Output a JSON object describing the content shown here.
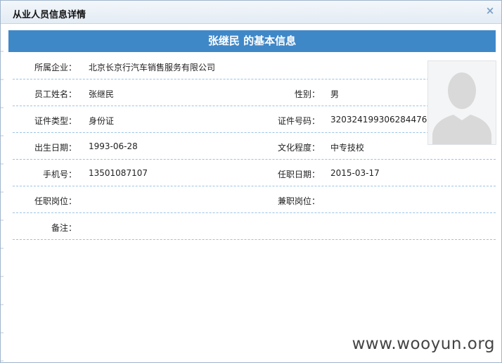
{
  "dialog": {
    "title": "从业人员信息详情",
    "close_icon": "×",
    "banner": "张继民 的基本信息"
  },
  "rows": [
    {
      "label": "所属企业：",
      "value": "北京长京行汽车销售服务有限公司"
    },
    {
      "label": "员工姓名：",
      "value": "张继民",
      "label2": "性别：",
      "value2": "男"
    },
    {
      "label": "证件类型：",
      "value": "身份证",
      "label2": "证件号码：",
      "value2": "320324199306284476"
    },
    {
      "label": "出生日期：",
      "value": "1993-06-28",
      "label2": "文化程度：",
      "value2": "中专技校"
    },
    {
      "label": "手机号：",
      "value": "13501087107",
      "label2": "任职日期：",
      "value2": "2015-03-17"
    },
    {
      "label": "任职岗位：",
      "value": "",
      "label2": "兼职岗位：",
      "value2": ""
    },
    {
      "label": "备注：",
      "value": ""
    }
  ],
  "photo": {
    "icon": "person-silhouette-icon"
  },
  "watermark": "www.wooyun.org"
}
